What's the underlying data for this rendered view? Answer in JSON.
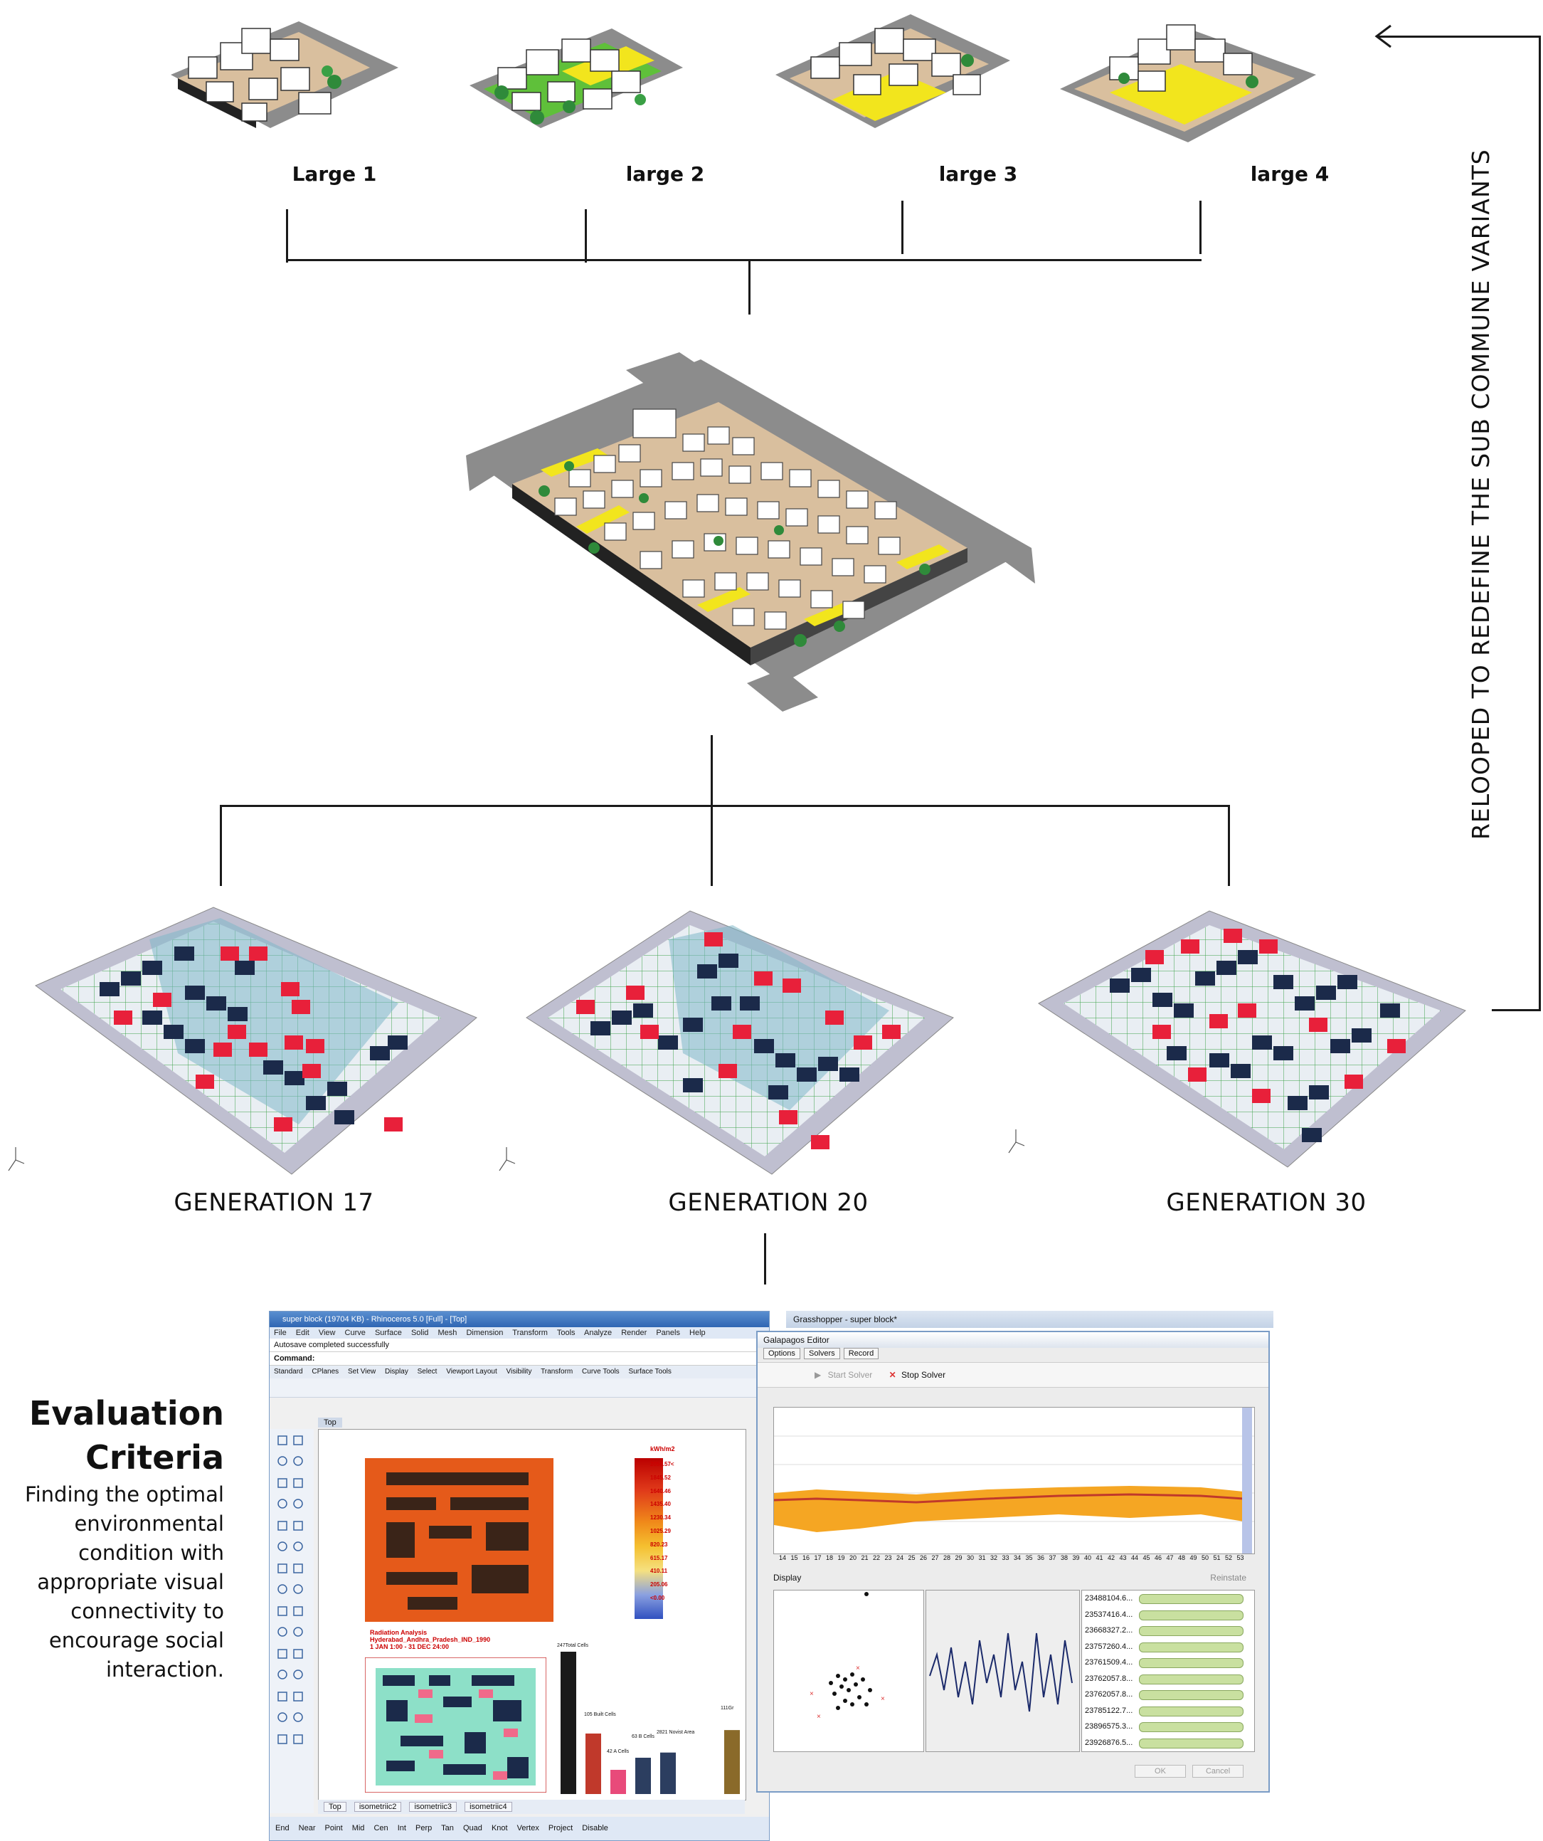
{
  "variants": [
    "Large 1",
    "large 2",
    "large 3",
    "large 4"
  ],
  "generations": [
    "GENERATION 17",
    "GENERATION 20",
    "GENERATION 30"
  ],
  "side_label": "RELOOPED TO REDEFINE THE SUB COMMUNE VARIANTS",
  "evaluation": {
    "title_line1": "Evaluation",
    "title_line2": "Criteria",
    "description": "Finding the optimal environmental condition with appropriate visual connectivity to encourage social interaction."
  },
  "rhino": {
    "title": "super block (19704 KB) - Rhinoceros 5.0 [Full] - [Top]",
    "menu": [
      "File",
      "Edit",
      "View",
      "Curve",
      "Surface",
      "Solid",
      "Mesh",
      "Dimension",
      "Transform",
      "Tools",
      "Analyze",
      "Render",
      "Panels",
      "Help"
    ],
    "status": "Autosave completed successfully",
    "command": "Command:",
    "toolbar_tabs": [
      "Standard",
      "CPlanes",
      "Set View",
      "Display",
      "Select",
      "Viewport Layout",
      "Visibility",
      "Transform",
      "Curve Tools",
      "Surface Tools"
    ],
    "viewport_tab": "Top",
    "legend_unit": "kWh/m2",
    "legend_values": [
      "2050.57<",
      "1845.52",
      "1640.46",
      "1435.40",
      "1230.34",
      "1025.29",
      "820.23",
      "615.17",
      "410.11",
      "205.06",
      "<0.00"
    ],
    "radiation_caption": [
      "Radiation Analysis",
      "Hyderabad_Andhra_Pradesh_IND_1990",
      "1 JAN 1:00 - 31 DEC 24:00"
    ],
    "bar_labels": [
      "247Total Cells",
      "105 Built Cells",
      "42 A Cells",
      "63 B Cells",
      "2821 Novist Area",
      "111Gr"
    ],
    "bar_values": [
      247,
      105,
      42,
      63,
      72,
      111
    ],
    "bottom_tabs": [
      "Top",
      "isometriic2",
      "isometriic3",
      "isometriic4"
    ],
    "osnaps": [
      "End",
      "Near",
      "Point",
      "Mid",
      "Cen",
      "Int",
      "Perp",
      "Tan",
      "Quad",
      "Knot",
      "Vertex",
      "Project",
      "Disable"
    ]
  },
  "grasshopper": {
    "outer_title": "Grasshopper - super block*",
    "title": "Galapagos Editor",
    "tabs": [
      "Options",
      "Solvers",
      "Record"
    ],
    "start": "Start Solver",
    "stop": "Stop Solver",
    "axis_ticks": [
      "14",
      "15",
      "16",
      "17",
      "18",
      "19",
      "20",
      "21",
      "22",
      "23",
      "24",
      "25",
      "26",
      "27",
      "28",
      "29",
      "30",
      "31",
      "32",
      "33",
      "34",
      "35",
      "36",
      "37",
      "38",
      "39",
      "40",
      "41",
      "42",
      "43",
      "44",
      "45",
      "46",
      "47",
      "48",
      "49",
      "50",
      "51",
      "52",
      "53"
    ],
    "display_label": "Display",
    "reinstate": "Reinstate",
    "fitness_values": [
      "23488104.6...",
      "23537416.4...",
      "23668327.2...",
      "23757260.4...",
      "23761509.4...",
      "23762057.8...",
      "23762057.8...",
      "23785122.7...",
      "23896575.3...",
      "23926876.5..."
    ],
    "ok": "OK",
    "cancel": "Cancel"
  },
  "colors": {
    "accent_red": "#e8203a",
    "navy": "#1b2a4a",
    "yellow": "#f2e51d",
    "green": "#5fc03a"
  }
}
